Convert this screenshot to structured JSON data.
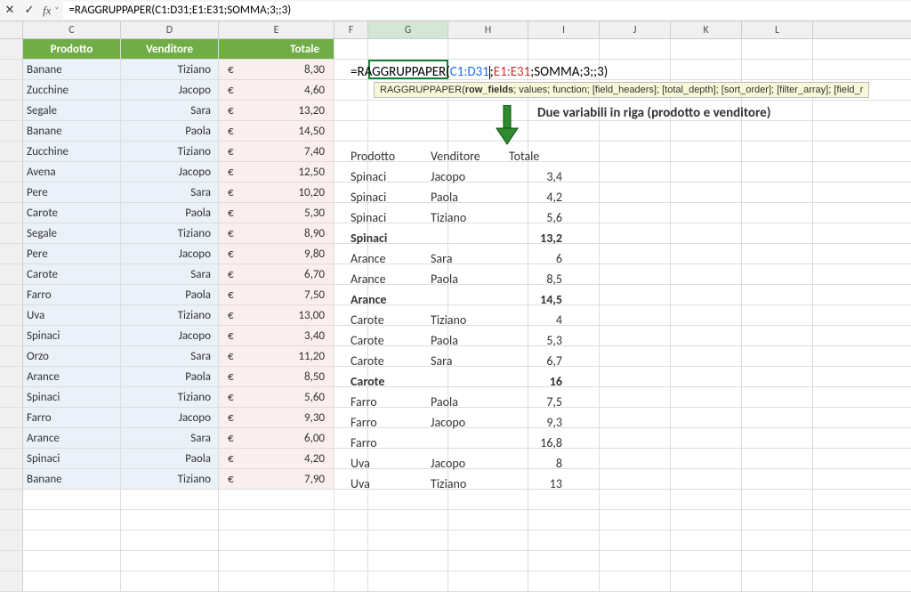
{
  "formula_bar": {
    "cancel_icon": "✕",
    "accept_icon": "✓",
    "fx_label": "fx",
    "dropdown_icon": "˅",
    "value": "=RAGGRUPPAPER(C1:D31;E1:E31;SOMMA;3;;3)"
  },
  "columns": [
    "C",
    "D",
    "E",
    "F",
    "G",
    "H",
    "I",
    "J",
    "K",
    "L"
  ],
  "headers": {
    "c": "Prodotto",
    "d": "Venditore",
    "e": "Totale"
  },
  "table_left": [
    {
      "c": "Banane",
      "d": "Tiziano",
      "e": "8,30"
    },
    {
      "c": "Zucchine",
      "d": "Jacopo",
      "e": "4,60"
    },
    {
      "c": "Segale",
      "d": "Sara",
      "e": "13,20"
    },
    {
      "c": "Banane",
      "d": "Paola",
      "e": "14,50"
    },
    {
      "c": "Zucchine",
      "d": "Tiziano",
      "e": "7,40"
    },
    {
      "c": "Avena",
      "d": "Jacopo",
      "e": "12,50"
    },
    {
      "c": "Pere",
      "d": "Sara",
      "e": "10,20"
    },
    {
      "c": "Carote",
      "d": "Paola",
      "e": "5,30"
    },
    {
      "c": "Segale",
      "d": "Tiziano",
      "e": "8,90"
    },
    {
      "c": "Pere",
      "d": "Jacopo",
      "e": "9,80"
    },
    {
      "c": "Carote",
      "d": "Sara",
      "e": "6,70"
    },
    {
      "c": "Farro",
      "d": "Paola",
      "e": "7,50"
    },
    {
      "c": "Uva",
      "d": "Tiziano",
      "e": "13,00"
    },
    {
      "c": "Spinaci",
      "d": "Jacopo",
      "e": "3,40"
    },
    {
      "c": "Orzo",
      "d": "Sara",
      "e": "11,20"
    },
    {
      "c": "Arance",
      "d": "Paola",
      "e": "8,50"
    },
    {
      "c": "Spinaci",
      "d": "Tiziano",
      "e": "5,60"
    },
    {
      "c": "Farro",
      "d": "Jacopo",
      "e": "9,30"
    },
    {
      "c": "Arance",
      "d": "Sara",
      "e": "6,00"
    },
    {
      "c": "Spinaci",
      "d": "Paola",
      "e": "4,20"
    },
    {
      "c": "Banane",
      "d": "Tiziano",
      "e": "7,90"
    }
  ],
  "euro": "€",
  "cell_formula": {
    "prefix": "=RAGGRUPPAPER(",
    "arg1": "C1:D31",
    "sep1": ";",
    "arg2": "E1:E31",
    "sep2": ";SOMMA;3;;3)"
  },
  "tooltip": {
    "fname": "RAGGRUPPAPER(",
    "b1": "row_fields",
    "rest": "; values; function; [field_headers]; [total_depth]; [sort_order]; [filter_array]; [field_r"
  },
  "annotation": "Due variabili in riga (prodotto e venditore)",
  "result_headers": {
    "c1": "Prodotto",
    "c2": "Venditore",
    "c3": "Totale"
  },
  "result_rows": [
    {
      "c1": "Spinaci",
      "c2": "Jacopo",
      "c3": "3,4",
      "bold": false
    },
    {
      "c1": "Spinaci",
      "c2": "Paola",
      "c3": "4,2",
      "bold": false
    },
    {
      "c1": "Spinaci",
      "c2": "Tiziano",
      "c3": "5,6",
      "bold": false
    },
    {
      "c1": "Spinaci",
      "c2": "",
      "c3": "13,2",
      "bold": true
    },
    {
      "c1": "Arance",
      "c2": "Sara",
      "c3": "6",
      "bold": false
    },
    {
      "c1": "Arance",
      "c2": "Paola",
      "c3": "8,5",
      "bold": false
    },
    {
      "c1": "Arance",
      "c2": "",
      "c3": "14,5",
      "bold": true
    },
    {
      "c1": "Carote",
      "c2": "Tiziano",
      "c3": "4",
      "bold": false
    },
    {
      "c1": "Carote",
      "c2": "Paola",
      "c3": "5,3",
      "bold": false
    },
    {
      "c1": "Carote",
      "c2": "Sara",
      "c3": "6,7",
      "bold": false
    },
    {
      "c1": "Carote",
      "c2": "",
      "c3": "16",
      "bold": true
    },
    {
      "c1": "Farro",
      "c2": "Paola",
      "c3": "7,5",
      "bold": false
    },
    {
      "c1": "Farro",
      "c2": "Jacopo",
      "c3": "9,3",
      "bold": false
    },
    {
      "c1": "Farro",
      "c2": "",
      "c3": "16,8",
      "bold": false
    },
    {
      "c1": "Uva",
      "c2": "Jacopo",
      "c3": "8",
      "bold": false
    },
    {
      "c1": "Uva",
      "c2": "Tiziano",
      "c3": "13",
      "bold": false
    }
  ]
}
